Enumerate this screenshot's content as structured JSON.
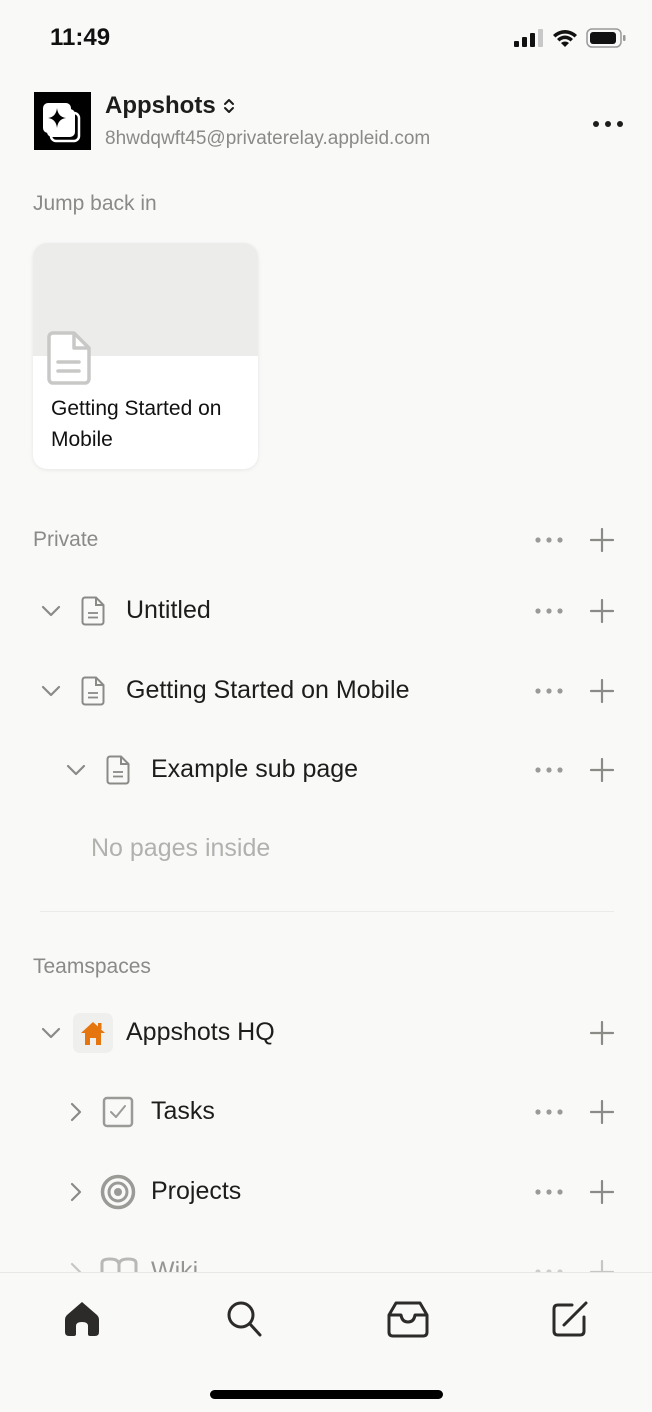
{
  "status_bar": {
    "time": "11:49",
    "icons": [
      "cellular-signal-icon",
      "wifi-icon",
      "battery-icon"
    ]
  },
  "workspace": {
    "name": "Appshots",
    "email": "8hwdqwft45@privaterelay.appleid.com",
    "switcher_icon": "chevron-up-down-icon",
    "more_icon": "ellipsis-icon"
  },
  "jump_back_in": {
    "label": "Jump back in",
    "cards": [
      {
        "title": "Getting Started on Mobile",
        "icon": "page-icon"
      }
    ]
  },
  "private": {
    "label": "Private",
    "items": [
      {
        "title": "Untitled",
        "icon": "page-icon",
        "expanded": true,
        "depth": 0
      },
      {
        "title": "Getting Started on Mobile",
        "icon": "page-icon",
        "expanded": true,
        "depth": 0
      },
      {
        "title": "Example sub page",
        "icon": "page-icon",
        "expanded": true,
        "depth": 1
      }
    ],
    "empty_note": "No pages inside"
  },
  "teamspaces": {
    "label": "Teamspaces",
    "items": [
      {
        "title": "Appshots HQ",
        "icon": "house-icon",
        "expanded": true,
        "depth": 0,
        "accent": "#e5750f"
      },
      {
        "title": "Tasks",
        "icon": "checkbox-icon",
        "expanded": false,
        "depth": 1
      },
      {
        "title": "Projects",
        "icon": "target-icon",
        "expanded": false,
        "depth": 1
      },
      {
        "title": "Wiki",
        "icon": "book-icon",
        "expanded": false,
        "depth": 1
      }
    ]
  },
  "tab_bar": {
    "tabs": [
      {
        "name": "home",
        "icon": "home-icon",
        "active": true
      },
      {
        "name": "search",
        "icon": "search-icon",
        "active": false
      },
      {
        "name": "inbox",
        "icon": "inbox-icon",
        "active": false
      },
      {
        "name": "new-page",
        "icon": "compose-icon",
        "active": false
      }
    ]
  }
}
